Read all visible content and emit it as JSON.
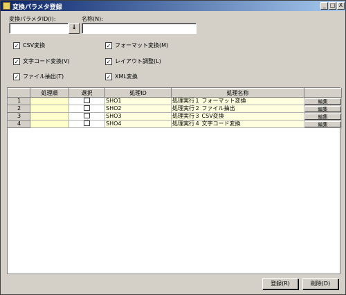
{
  "window": {
    "title": "変換パラメタ登録",
    "min": "_",
    "max": "□",
    "close": "X"
  },
  "form": {
    "param_id_label": "変換パラメタID(I):",
    "param_id_value": "",
    "name_label": "名称(N):",
    "name_value": "",
    "dropdown_glyph": "↓"
  },
  "checkboxes": [
    {
      "label": "CSV変換",
      "checked": true
    },
    {
      "label": "フォーマット変換(M)",
      "checked": true
    },
    {
      "label": "文字コード変換(V)",
      "checked": true
    },
    {
      "label": "レイアウト調整(L)",
      "checked": true
    },
    {
      "label": "ファイル抽出(T)",
      "checked": true
    },
    {
      "label": "XML変換",
      "checked": true
    }
  ],
  "grid": {
    "columns": [
      "",
      "処理順",
      "選択",
      "処理ID",
      "処理名称",
      ""
    ],
    "rows": [
      {
        "num": "1",
        "order": "",
        "id": "SHO1",
        "name": "処理実行１ フォーマット変換",
        "action": "編集"
      },
      {
        "num": "2",
        "order": "",
        "id": "SHO2",
        "name": "処理実行２ ファイル抽出",
        "action": "編集"
      },
      {
        "num": "3",
        "order": "",
        "id": "SHO3",
        "name": "処理実行３ CSV変換",
        "action": "編集"
      },
      {
        "num": "4",
        "order": "",
        "id": "SHO4",
        "name": "処理実行４ 文字コード変換",
        "action": "編集"
      }
    ]
  },
  "buttons": {
    "register": "登録(R)",
    "delete": "削除(D)"
  }
}
